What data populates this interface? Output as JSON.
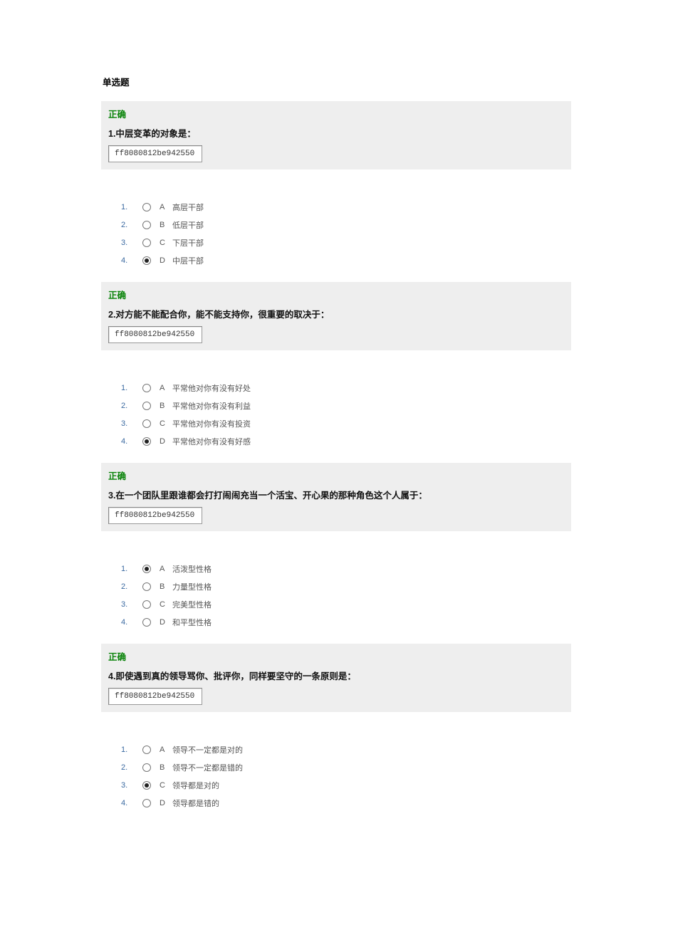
{
  "section_title": "单选题",
  "correct_label": "正确",
  "code_text": "ff8080812be942550",
  "questions": [
    {
      "number": "1.",
      "text": "中层变革的对象是：",
      "selected_index": 3,
      "options": [
        {
          "num": "1.",
          "letter": "A",
          "label": "高层干部"
        },
        {
          "num": "2.",
          "letter": "B",
          "label": "低层干部"
        },
        {
          "num": "3.",
          "letter": "C",
          "label": "下层干部"
        },
        {
          "num": "4.",
          "letter": "D",
          "label": "中层干部"
        }
      ]
    },
    {
      "number": "2.",
      "text": "对方能不能配合你，能不能支持你，很重要的取决于：",
      "selected_index": 3,
      "options": [
        {
          "num": "1.",
          "letter": "A",
          "label": "平常他对你有没有好处"
        },
        {
          "num": "2.",
          "letter": "B",
          "label": "平常他对你有没有利益"
        },
        {
          "num": "3.",
          "letter": "C",
          "label": "平常他对你有没有投资"
        },
        {
          "num": "4.",
          "letter": "D",
          "label": "平常他对你有没有好感"
        }
      ]
    },
    {
      "number": "3.",
      "text": "在一个团队里跟谁都会打打闹闹充当一个活宝、开心果的那种角色这个人属于：",
      "selected_index": 0,
      "options": [
        {
          "num": "1.",
          "letter": "A",
          "label": "活泼型性格"
        },
        {
          "num": "2.",
          "letter": "B",
          "label": "力量型性格"
        },
        {
          "num": "3.",
          "letter": "C",
          "label": "完美型性格"
        },
        {
          "num": "4.",
          "letter": "D",
          "label": "和平型性格"
        }
      ]
    },
    {
      "number": "4.",
      "text": "即使遇到真的领导骂你、批评你，同样要坚守的一条原则是：",
      "selected_index": 2,
      "options": [
        {
          "num": "1.",
          "letter": "A",
          "label": "领导不一定都是对的"
        },
        {
          "num": "2.",
          "letter": "B",
          "label": "领导不一定都是错的"
        },
        {
          "num": "3.",
          "letter": "C",
          "label": "领导都是对的"
        },
        {
          "num": "4.",
          "letter": "D",
          "label": "领导都是错的"
        }
      ]
    }
  ]
}
